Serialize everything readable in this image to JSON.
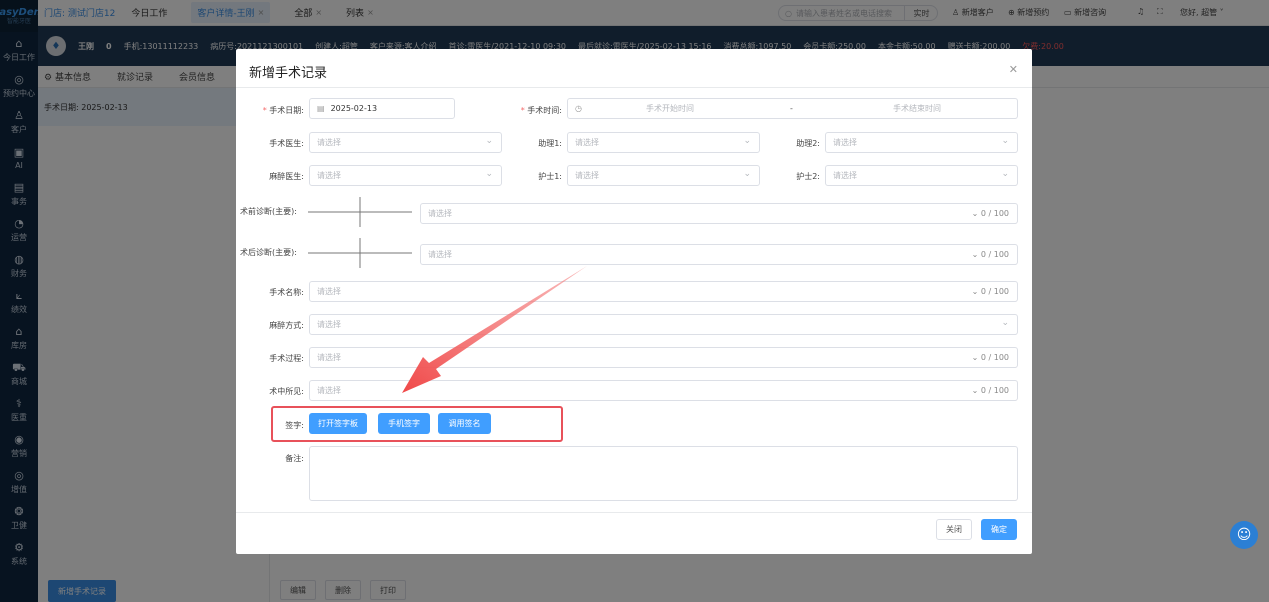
{
  "sidebar": {
    "logo": "EasyDent",
    "logo_sub": "智能牙医",
    "items": [
      {
        "icon": "home-icon",
        "glyph": "⌂",
        "label": "今日工作"
      },
      {
        "icon": "appointment-icon",
        "glyph": "◎",
        "label": "预约中心"
      },
      {
        "icon": "user-icon",
        "glyph": "♙",
        "label": "客户"
      },
      {
        "icon": "ai-icon",
        "glyph": "▣",
        "label": "AI"
      },
      {
        "icon": "task-icon",
        "glyph": "▤",
        "label": "事务"
      },
      {
        "icon": "operation-icon",
        "glyph": "◔",
        "label": "运营"
      },
      {
        "icon": "finance-icon",
        "glyph": "◍",
        "label": "财务"
      },
      {
        "icon": "performance-icon",
        "glyph": "⟀",
        "label": "绩效"
      },
      {
        "icon": "warehouse-icon",
        "glyph": "⌂",
        "label": "库房"
      },
      {
        "icon": "mall-icon",
        "glyph": "⛟",
        "label": "商城"
      },
      {
        "icon": "medical-icon",
        "glyph": "⚕",
        "label": "医重"
      },
      {
        "icon": "marketing-icon",
        "glyph": "◉",
        "label": "营销"
      },
      {
        "icon": "value-added-icon",
        "glyph": "◎",
        "label": "增值"
      },
      {
        "icon": "health-icon",
        "glyph": "❂",
        "label": "卫健"
      },
      {
        "icon": "system-icon",
        "glyph": "⚙",
        "label": "系统"
      }
    ]
  },
  "topbar": {
    "store": "门店: 测试门店12",
    "tabs": [
      {
        "label": "今日工作",
        "closable": false,
        "active": false
      },
      {
        "label": "客户详情-王刚",
        "closable": true,
        "active": true
      },
      {
        "label": "全部",
        "closable": true,
        "active": false
      },
      {
        "label": "列表",
        "closable": true,
        "active": false
      }
    ],
    "search_placeholder": "请输入患者姓名或电话搜索",
    "realtime": "实时",
    "actions": [
      "新增客户",
      "新增预约",
      "新增咨询"
    ],
    "greeting": "您好, 超管"
  },
  "patient": {
    "name": "王刚",
    "age": "0",
    "phone": "手机:13011112233",
    "record_no": "病历号:2021121300101",
    "creator": "创建人:超管",
    "source": "客户来源:客人介绍",
    "first_visit": "首诊:雷医生/2021-12-10 09:30",
    "last_visit": "最后就诊:雷医生/2025-02-13 15:16",
    "total": "消费总额:1097.50",
    "balance": "会员卡额:250.00",
    "principal": "本金卡额:50.00",
    "gift": "赠送卡额:200.00",
    "debt": "欠费:20.00"
  },
  "subtabs": [
    "基本信息",
    "就诊记录",
    "会员信息"
  ],
  "left_list": {
    "row": "手术日期: 2025-02-13",
    "add_button": "新增手术记录"
  },
  "bottom_buttons": [
    "编辑",
    "删除",
    "打印"
  ],
  "modal": {
    "title": "新增手术记录",
    "labels": {
      "surgery_date": "手术日期:",
      "surgery_time": "手术时间:",
      "surgeon": "手术医生:",
      "assistant1": "助理1:",
      "assistant2": "助理2:",
      "anesthetist": "麻醉医生:",
      "nurse1": "护士1:",
      "nurse2": "护士2:",
      "pre_diag": "术前诊断(主要):",
      "post_diag": "术后诊断(主要):",
      "surgery_name": "手术名称:",
      "anesthesia": "麻醉方式:",
      "process": "手术过程:",
      "findings": "术中所见:",
      "signature": "签字:",
      "remark": "备注:"
    },
    "values": {
      "surgery_date": "2025-02-13",
      "start_time_placeholder": "手术开始时间",
      "range_sep": "-",
      "end_time_placeholder": "手术结束时间",
      "select_placeholder": "请选择",
      "counter": "0 / 100"
    },
    "sign_buttons": [
      "打开签字板",
      "手机签字",
      "调用签名"
    ],
    "close": "关闭",
    "confirm": "确定"
  }
}
